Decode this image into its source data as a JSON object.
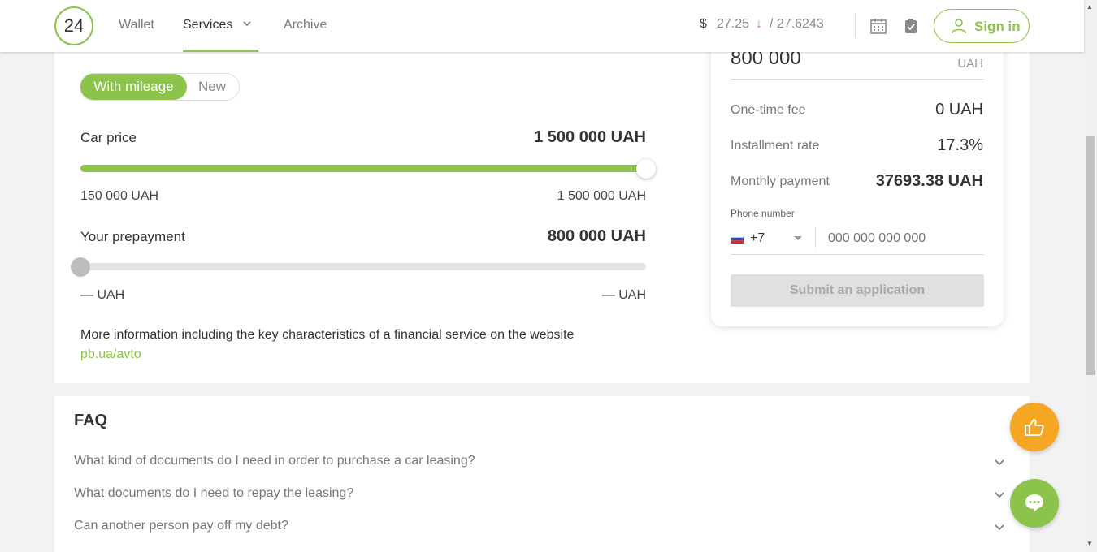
{
  "header": {
    "logo_text": "24",
    "nav": [
      "Wallet",
      "Services",
      "Archive"
    ],
    "currency_symbol": "$",
    "rate_buy": "27.25",
    "rate_trend_icon": "arrow-down",
    "rate_sell": "/ 27.6243",
    "sign_in_label": "Sign in"
  },
  "calculator": {
    "toggle": {
      "active": "With mileage",
      "inactive": "New"
    },
    "car_price": {
      "label": "Car price",
      "value": "1 500 000 UAH",
      "min_label": "150 000 UAH",
      "max_label": "1 500 000 UAH",
      "slider_fraction": 1.0
    },
    "prepayment": {
      "label": "Your prepayment",
      "value": "800 000 UAH",
      "min_label": "— UAH",
      "max_label": "— UAH",
      "slider_fraction": 0.0
    },
    "info_text": "More information including the key characteristics of a financial service on the website ",
    "info_link": "pb.ua/avto"
  },
  "summary": {
    "amount_value": "800 000",
    "amount_currency": "UAH",
    "one_time_fee_label": "One-time fee",
    "one_time_fee_value": "0 UAH",
    "installment_rate_label": "Installment rate",
    "installment_rate_value": "17.3%",
    "monthly_payment_label": "Monthly payment",
    "monthly_payment_value": "37693.38 UAH",
    "phone_label": "Phone number",
    "phone_code": "+7",
    "phone_placeholder": "000 000 000 000",
    "submit_label": "Submit an application"
  },
  "faq": {
    "title": "FAQ",
    "questions": [
      "What kind of documents do I need in order to purchase a car leasing?",
      "What documents do I need to repay the leasing?",
      "Can another person pay off my debt?"
    ]
  },
  "colors": {
    "accent": "#8cc34b",
    "like_button": "#f5a623",
    "rate_down": "#e57373"
  },
  "icons": [
    "chevron-down-icon",
    "calendar-icon",
    "clipboard-check-icon",
    "user-icon",
    "flag-ru-icon",
    "thumbs-up-icon",
    "chat-icon"
  ]
}
